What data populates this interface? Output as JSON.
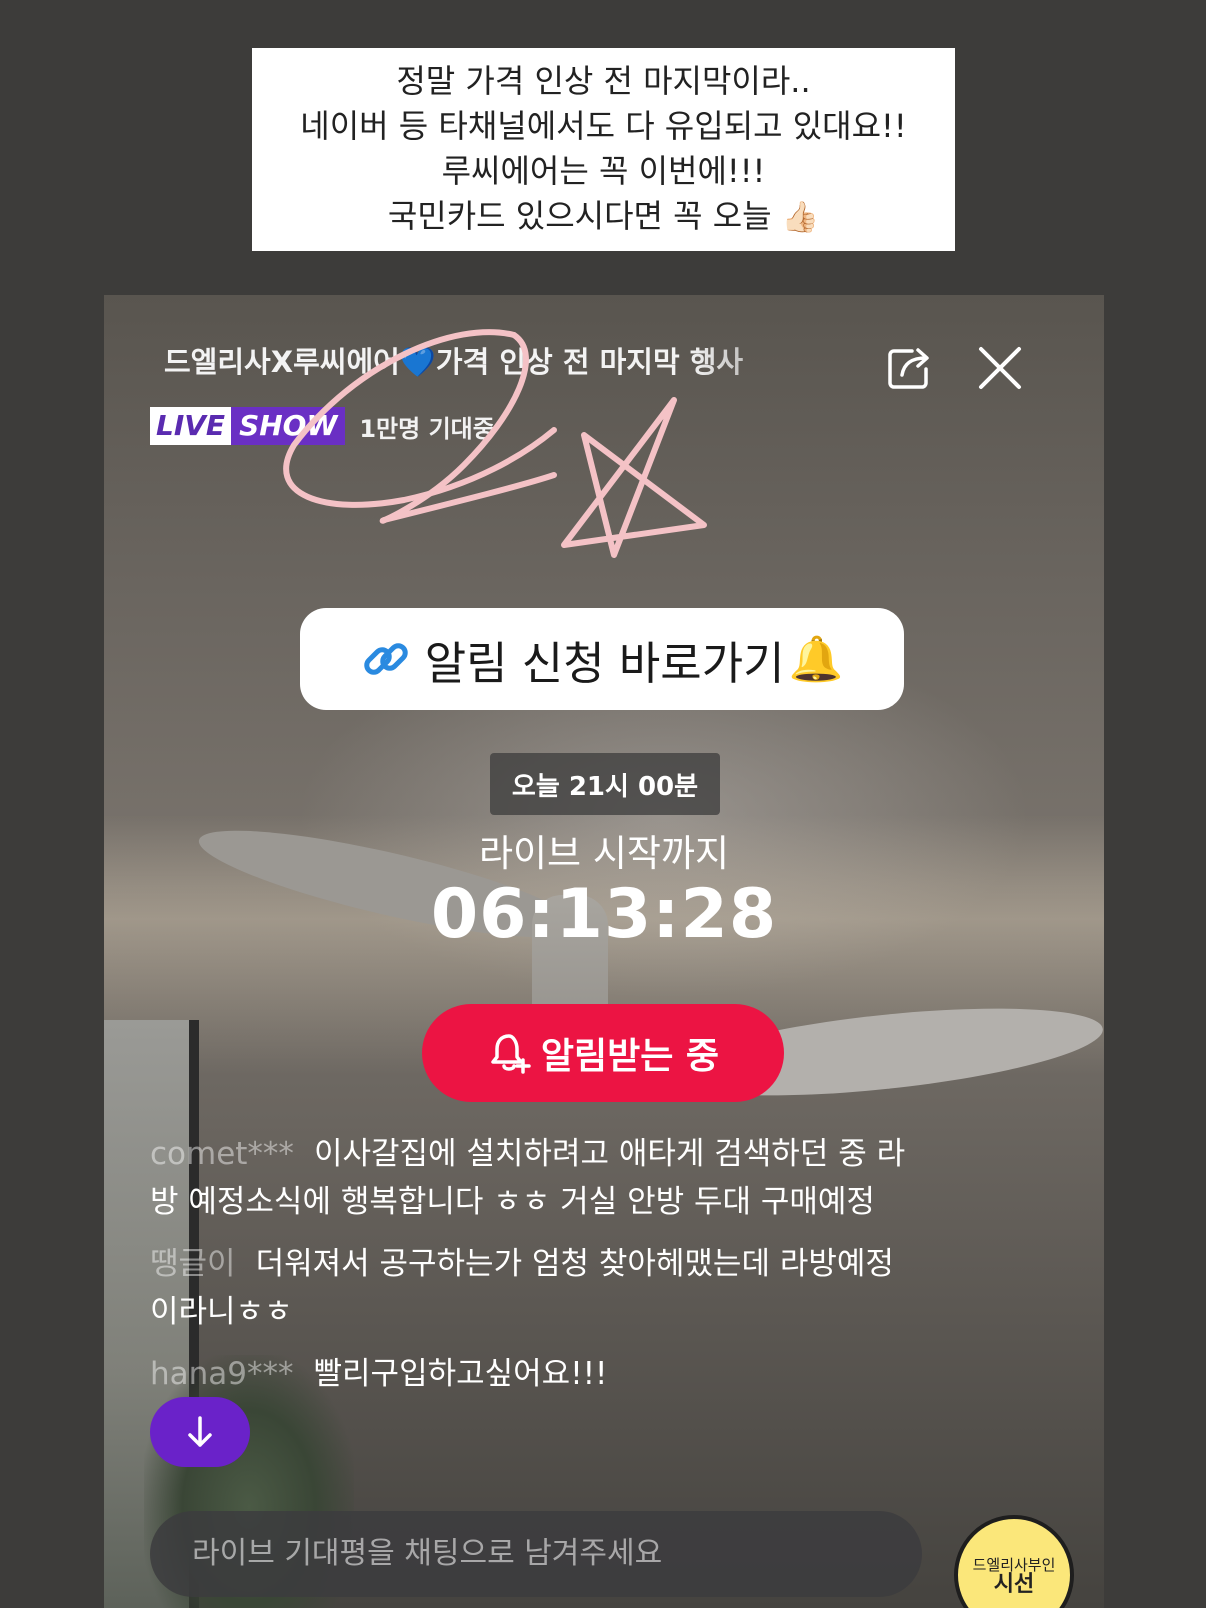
{
  "caption": {
    "lines": [
      "정말 가격 인상 전 마지막이라..",
      "네이버 등 타채널에서도 다 유입되고 있대요!!",
      "루씨에어는 꼭 이번에!!!",
      "국민카드 있으시다면 꼭 오늘"
    ],
    "emoji": "👍🏻"
  },
  "header": {
    "title": "드엘리사X루씨에어💙가격 인상 전 마지막 행사",
    "share_icon": "share-icon",
    "close_icon": "close-icon"
  },
  "badge": {
    "live_part1": "LIVE",
    "live_part2": "SHOW",
    "expect_text": "1만명 기대중"
  },
  "alarm_link": {
    "label": "알림 신청 바로가기",
    "bell": "🔔",
    "icon": "link-icon"
  },
  "schedule": {
    "time": "오늘 21시 00분",
    "until_label": "라이브 시작까지",
    "countdown": "06:13:28"
  },
  "notify_button": {
    "label": "알림받는 중",
    "icon": "bell-plus-icon",
    "color": "#ec1443"
  },
  "chat": {
    "messages": [
      {
        "user": "comet***",
        "text": "이사갈집에 설치하려고 애타게 검색하던 중 라방 예정소식에 행복합니다 ㅎㅎ 거실 안방 두대 구매예정"
      },
      {
        "user": "땡글이",
        "text": "더워져서 공구하는가 엄청 찾아헤맸는데 라방예정이라니ㅎㅎ"
      },
      {
        "user": "hana9***",
        "text": "빨리구입하고싶어요!!!"
      }
    ],
    "input_placeholder": "라이브 기대평을 채팅으로 남겨주세요",
    "scroll_icon": "arrow-down-icon"
  },
  "sticker": {
    "line1": "드엘리사부인",
    "line2": "시선"
  },
  "colors": {
    "accent_purple": "#6a22c9",
    "notify_red": "#ec1443",
    "doodle_pink": "#f4c2c6"
  }
}
